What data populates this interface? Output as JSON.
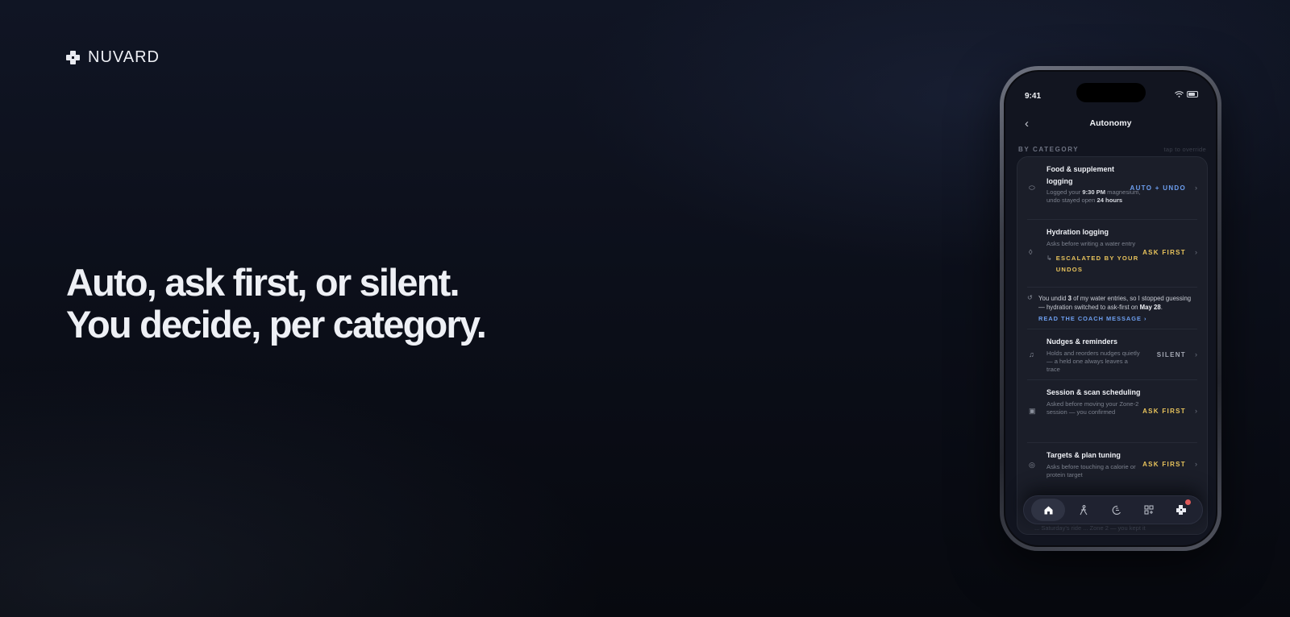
{
  "brand": {
    "name": "NUVARD"
  },
  "headline": {
    "line1": "Auto, ask first, or silent.",
    "line2": "You decide, per category."
  },
  "phone": {
    "status_time": "9:41",
    "nav": {
      "back_icon": "chevron-left-icon",
      "title": "Autonomy"
    },
    "section": {
      "label": "BY CATEGORY",
      "hint": "tap to override"
    },
    "rows": [
      {
        "title": "Food & supplement logging",
        "desc_pre": "Logged your ",
        "desc_bold1": "9:30 PM",
        "desc_mid": " magnesium, undo stayed open ",
        "desc_bold2": "24 hours",
        "mode": "AUTO + UNDO",
        "mode_color": "#6d9ff0",
        "icon": "pill-icon"
      },
      {
        "title": "Hydration logging",
        "desc": "Asks before writing a water entry",
        "escalated": "ESCALATED BY YOUR UNDOS",
        "mode": "ASK FIRST",
        "mode_color": "#e9c45c",
        "icon": "droplet-icon"
      },
      {
        "title": "Nudges & reminders",
        "desc": "Holds and reorders nudges quietly — a held one always leaves a trace",
        "mode": "SILENT",
        "mode_color": "#a4a8b3",
        "icon": "bell-icon"
      },
      {
        "title": "Session & scan scheduling",
        "desc": "Asked before moving your Zone-2 session — you confirmed",
        "mode": "ASK FIRST",
        "mode_color": "#e9c45c",
        "icon": "calendar-icon"
      },
      {
        "title": "Targets & plan tuning",
        "desc": "Asks before touching a calorie or protein target",
        "mode": "ASK FIRST",
        "mode_color": "#e9c45c",
        "icon": "target-icon"
      }
    ],
    "coach": {
      "pre": "You undid ",
      "count": "3",
      "mid": " of my water entries, so I stopped guessing — hydration switched to ask-first on ",
      "date": "May 28",
      "post": ".",
      "link": "READ THE COACH MESSAGE"
    },
    "faded_text": "... Saturday's ride ... Zone 2 — you kept it",
    "tabs": [
      {
        "name": "home-icon",
        "active": true
      },
      {
        "name": "activity-icon",
        "active": false
      },
      {
        "name": "nutrition-icon",
        "active": false
      },
      {
        "name": "grid-icon",
        "active": false
      },
      {
        "name": "coach-logo-icon",
        "active": false,
        "badge": true
      }
    ]
  }
}
